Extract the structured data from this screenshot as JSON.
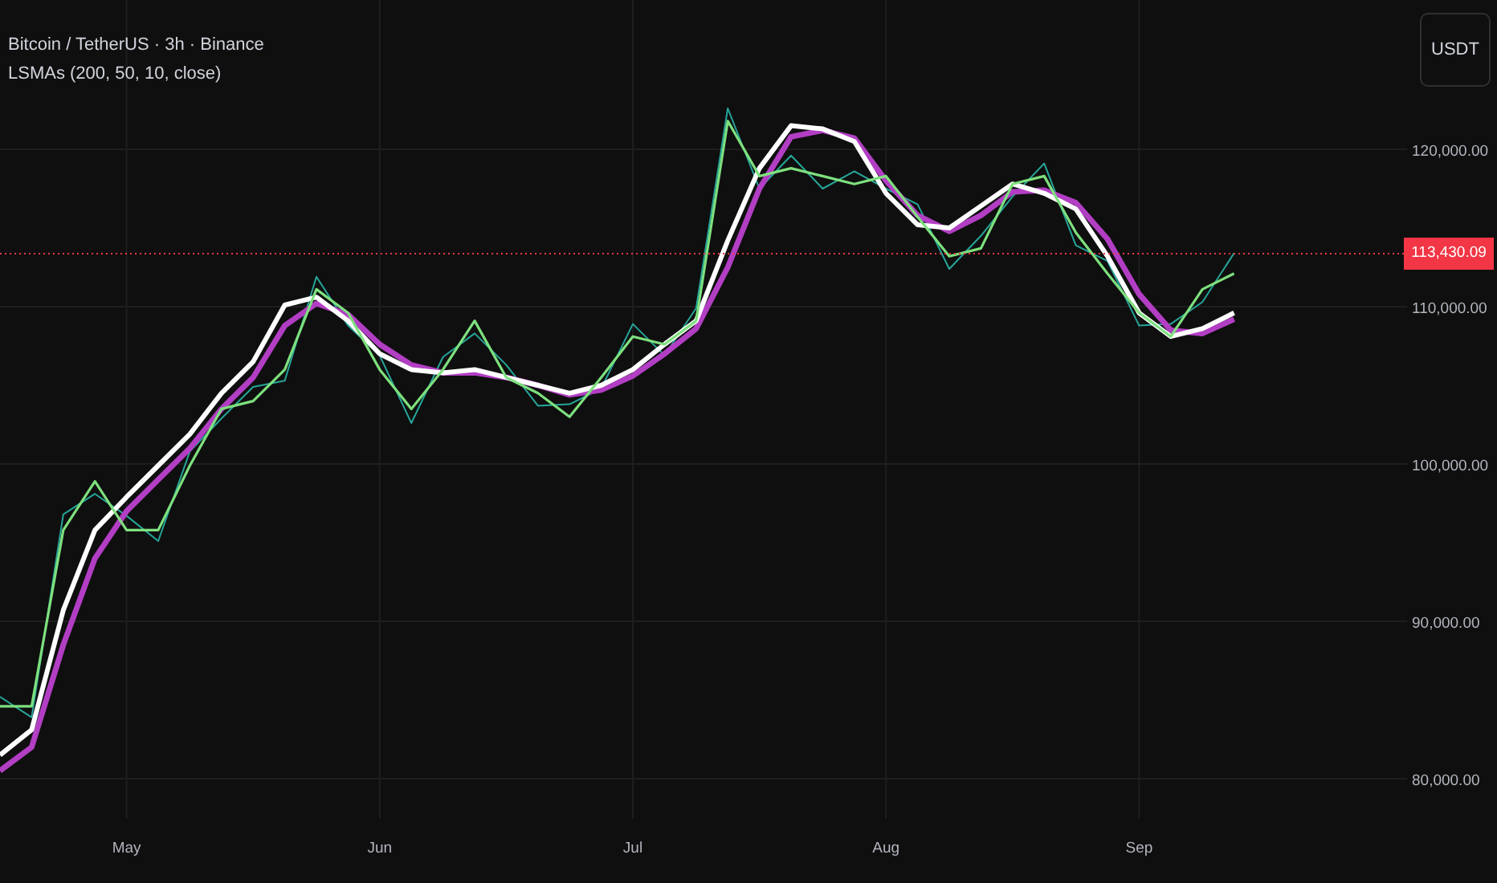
{
  "header": {
    "title": "Bitcoin / TetherUS · 3h · Binance",
    "indicator": "LSMAs (200, 50, 10, close)"
  },
  "currency_button": "USDT",
  "last_price": {
    "label": "113,430.09",
    "color": "#f23645"
  },
  "chart_data": {
    "type": "line",
    "ylim": [
      77450,
      129490
    ],
    "grid": true,
    "categories": [
      null,
      null,
      null,
      null,
      "May",
      null,
      null,
      null,
      null,
      null,
      null,
      null,
      "Jun",
      null,
      null,
      null,
      null,
      null,
      null,
      null,
      "Jul",
      null,
      null,
      null,
      null,
      null,
      null,
      null,
      "Aug",
      null,
      null,
      null,
      null,
      null,
      null,
      null,
      "Sep",
      null,
      null,
      null
    ],
    "yticks": [
      {
        "value": 80000,
        "label": "80,000.00"
      },
      {
        "value": 90000,
        "label": "90,000.00"
      },
      {
        "value": 100000,
        "label": "100,000.00"
      },
      {
        "value": 110000,
        "label": "110,000.00"
      },
      {
        "value": 120000,
        "label": "120,000.00"
      }
    ],
    "series": [
      {
        "color": "#26a69a",
        "values": [
          85200,
          83900,
          96800,
          98100,
          96700,
          95100,
          100800,
          102900,
          104900,
          105300,
          111900,
          108800,
          106900,
          102600,
          106800,
          108300,
          106300,
          103700,
          103800,
          104800,
          108900,
          106900,
          109900,
          122600,
          117500,
          119600,
          117500,
          118600,
          117500,
          116500,
          112400,
          114500,
          117000,
          119100,
          113900,
          112900,
          108800,
          108900,
          110300,
          113400
        ]
      },
      {
        "color": "#b23ec4",
        "values": [
          80500,
          82000,
          88500,
          94000,
          97000,
          99000,
          101000,
          103500,
          105500,
          108800,
          110200,
          109500,
          107600,
          106300,
          105800,
          105800,
          105500,
          105000,
          104400,
          104700,
          105600,
          107000,
          108600,
          112500,
          117500,
          120800,
          121200,
          120700,
          118000,
          115800,
          114800,
          115800,
          117300,
          117400,
          116600,
          114300,
          110800,
          108500,
          108300,
          109200
        ]
      },
      {
        "color": "#ffffff",
        "values": [
          81500,
          83100,
          90700,
          95800,
          97900,
          99900,
          101900,
          104500,
          106500,
          110100,
          110600,
          109100,
          107000,
          106000,
          105800,
          106000,
          105500,
          105000,
          104500,
          105000,
          106000,
          107600,
          109100,
          114200,
          118800,
          121500,
          121300,
          120500,
          117200,
          115200,
          115000,
          116400,
          117800,
          117200,
          116200,
          113200,
          109600,
          108100,
          108600,
          109600
        ]
      },
      {
        "color": "#7ee07e",
        "values": [
          84600,
          84600,
          95800,
          98900,
          95800,
          95800,
          99900,
          103500,
          104000,
          106000,
          111100,
          109600,
          106000,
          103500,
          106000,
          109100,
          105500,
          104500,
          103000,
          105500,
          108100,
          107600,
          109100,
          121800,
          118300,
          118800,
          118300,
          117800,
          118300,
          115700,
          113200,
          113700,
          117800,
          118300,
          114700,
          112100,
          109600,
          108100,
          111100,
          112100
        ]
      }
    ]
  }
}
